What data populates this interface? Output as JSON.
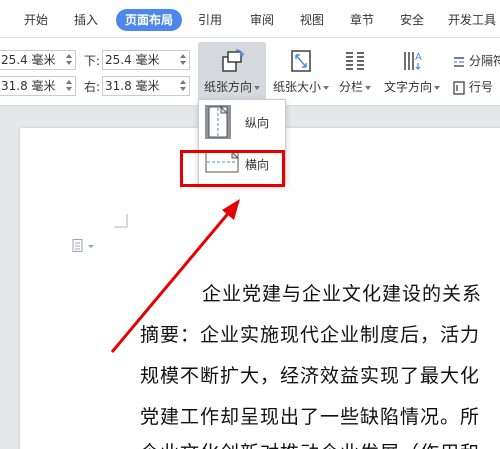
{
  "tabs": [
    {
      "label": "开始"
    },
    {
      "label": "插入"
    },
    {
      "label": "页面布局"
    },
    {
      "label": "引用"
    },
    {
      "label": "审阅"
    },
    {
      "label": "视图"
    },
    {
      "label": "章节"
    },
    {
      "label": "安全"
    },
    {
      "label": "开发工具"
    }
  ],
  "margins": {
    "top_value": "25.4 毫米",
    "bottom_label": "下:",
    "bottom_value": "25.4 毫米",
    "left_value": "31.8 毫米",
    "right_label": "右:",
    "right_value": "31.8 毫米"
  },
  "toolbar": {
    "orientation_label": "纸张方向",
    "size_label": "纸张大小",
    "columns_label": "分栏",
    "text_direction_label": "文字方向",
    "separator_label": "分隔符",
    "line_number_label": "行号"
  },
  "orientation_menu": {
    "portrait": "纵向",
    "landscape": "横向"
  },
  "document": {
    "lines": [
      "企业党建与企业文化建设的关系",
      "摘要：企业实施现代企业制度后，活力",
      "规模不断扩大，经济效益实现了最大化",
      "党建工作却呈现出了一些缺陷情况。所",
      "企业文化创新对推动企业发展（作用和"
    ]
  },
  "colors": {
    "accent": "#4d87ea",
    "highlight": "#e60000"
  }
}
